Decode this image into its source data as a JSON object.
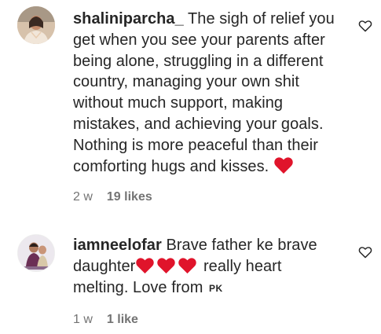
{
  "comments": [
    {
      "username": "shaliniparcha_",
      "text": "The sigh of relief you get when you see your parents after being alone, struggling in a different country, managing your own shit without much support, making mistakes, and achieving your goals. Nothing is more peaceful than their comforting hugs and kisses.",
      "emoji": "red-heart",
      "time": "2 w",
      "likes": "19 likes"
    },
    {
      "username": "iamneelofar",
      "text_before": "Brave father ke brave daughter",
      "emoji_count": 3,
      "text_after": "really heart melting. Love from",
      "flag_text": "PK",
      "time": "1 w",
      "likes": "1 like"
    }
  ],
  "colors": {
    "text": "#262626",
    "meta": "#737373",
    "heart": "#e0142b"
  }
}
